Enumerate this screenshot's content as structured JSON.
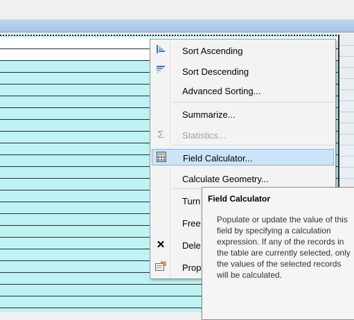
{
  "menu": {
    "items": [
      {
        "label": "Sort Ascending",
        "icon": "sort-ascending-icon"
      },
      {
        "label": "Sort Descending",
        "icon": "sort-descending-icon"
      },
      {
        "label": "Advanced Sorting...",
        "icon": ""
      },
      {
        "label": "Summarize...",
        "icon": ""
      },
      {
        "label": "Statistics...",
        "icon": "sigma-icon",
        "disabled": true
      },
      {
        "label": "Field Calculator...",
        "icon": "calculator-icon",
        "highlighted": true
      },
      {
        "label": "Calculate Geometry...",
        "icon": ""
      },
      {
        "label": "Turn",
        "icon": ""
      },
      {
        "label": "Free",
        "icon": ""
      },
      {
        "label": "Dele",
        "icon": "delete-x-icon"
      },
      {
        "label": "Prop",
        "icon": "properties-icon"
      }
    ]
  },
  "tooltip": {
    "title": "Field Calculator",
    "body": "Populate or update the value of this field by specifying a calculation expression. If any of the records in the table are currently selected, only the values of the selected records will be calculated."
  },
  "colors": {
    "table_fill": "#bff3f3",
    "highlight": "#cce4f7",
    "highlight_border": "#7eb4ea"
  }
}
